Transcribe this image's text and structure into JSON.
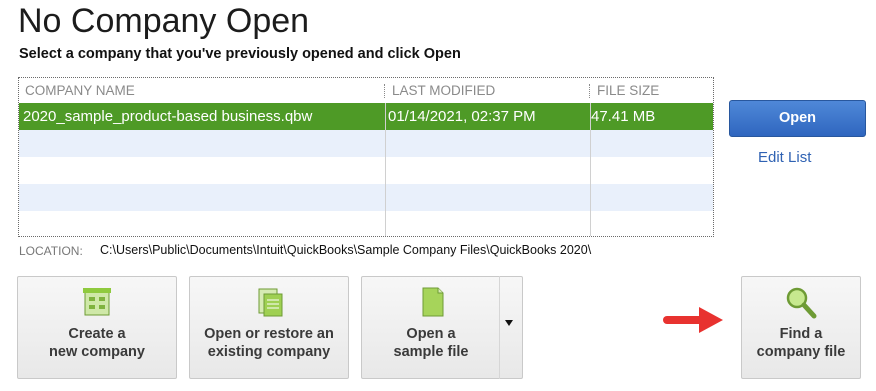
{
  "header": {
    "title": "No Company Open",
    "subtitle": "Select a company that you've previously opened and click Open"
  },
  "company_list": {
    "columns": [
      "COMPANY NAME",
      "LAST MODIFIED",
      "FILE SIZE"
    ],
    "rows": [
      {
        "name": "2020_sample_product-based business.qbw",
        "modified": "01/14/2021, 02:37 PM",
        "size": "47.41 MB",
        "selected": true
      }
    ],
    "selected_color": "#4e9a26"
  },
  "actions": {
    "open_label": "Open",
    "edit_list_label": "Edit List"
  },
  "location": {
    "label": "LOCATION:",
    "path": "C:\\Users\\Public\\Documents\\Intuit\\QuickBooks\\Sample Company Files\\QuickBooks 2020\\"
  },
  "tiles": [
    {
      "line1": "Create a",
      "line2": "new company",
      "icon": "new-company-icon"
    },
    {
      "line1": "Open or restore an",
      "line2": "existing company",
      "icon": "open-restore-icon"
    },
    {
      "line1": "Open a",
      "line2": "sample file",
      "icon": "sample-file-icon"
    },
    {
      "line1": "Find a",
      "line2": "company file",
      "icon": "magnifier-icon"
    }
  ],
  "colors": {
    "accent_blue": "#2f66bf",
    "icon_green": "#8fca3e",
    "arrow_red": "#e8322f"
  }
}
